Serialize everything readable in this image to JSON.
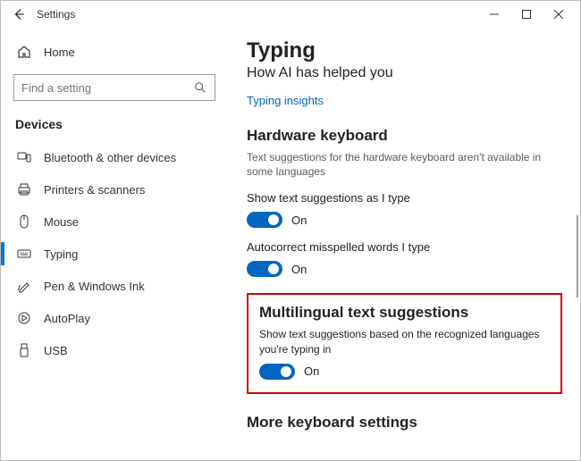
{
  "window": {
    "title": "Settings"
  },
  "sidebar": {
    "home": "Home",
    "search_placeholder": "Find a setting",
    "category": "Devices",
    "items": [
      {
        "label": "Bluetooth & other devices"
      },
      {
        "label": "Printers & scanners"
      },
      {
        "label": "Mouse"
      },
      {
        "label": "Typing"
      },
      {
        "label": "Pen & Windows Ink"
      },
      {
        "label": "AutoPlay"
      },
      {
        "label": "USB"
      }
    ]
  },
  "main": {
    "heading": "Typing",
    "subheading": "How AI has helped you",
    "link": "Typing insights",
    "hw_heading": "Hardware keyboard",
    "hw_desc": "Text suggestions for the hardware keyboard aren't available in some languages",
    "setting1_label": "Show text suggestions as I type",
    "setting1_state": "On",
    "setting2_label": "Autocorrect misspelled words I type",
    "setting2_state": "On",
    "ml_heading": "Multilingual text suggestions",
    "ml_desc": "Show text suggestions based on the recognized languages you're typing in",
    "ml_state": "On",
    "more_heading": "More keyboard settings"
  }
}
